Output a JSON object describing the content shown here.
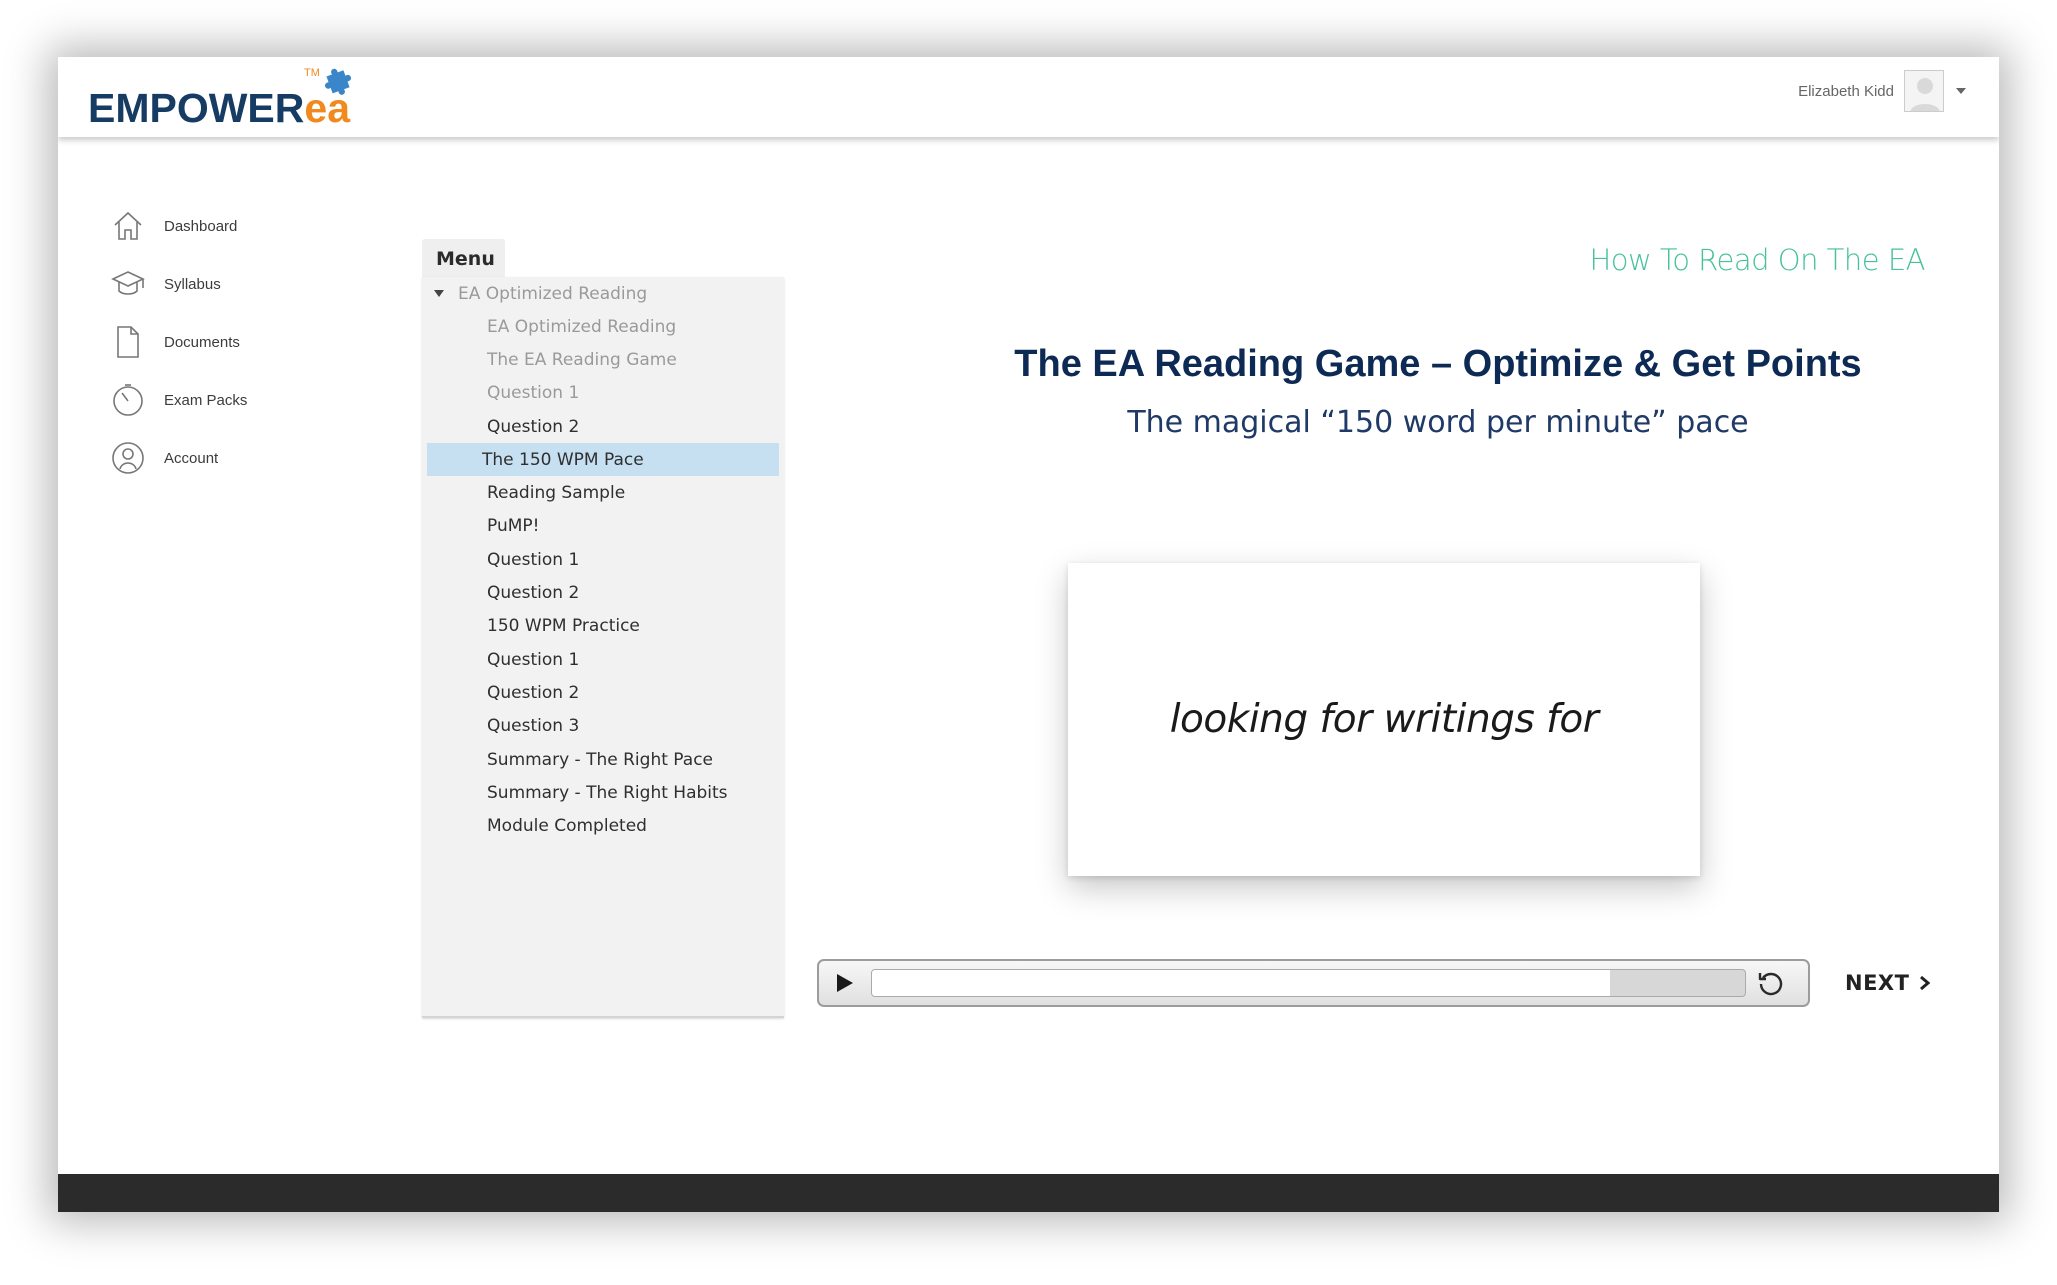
{
  "header": {
    "logo_main": "EMPOWER",
    "logo_accent": "ea",
    "logo_tm": "TM",
    "user_name": "Elizabeth Kidd"
  },
  "sidebar": {
    "items": [
      {
        "label": "Dashboard",
        "icon": "home-icon"
      },
      {
        "label": "Syllabus",
        "icon": "graduation-cap-icon"
      },
      {
        "label": "Documents",
        "icon": "document-icon"
      },
      {
        "label": "Exam Packs",
        "icon": "timer-icon"
      },
      {
        "label": "Account",
        "icon": "user-icon"
      }
    ]
  },
  "menu": {
    "title": "Menu",
    "root": "EA Optimized Reading",
    "items": [
      {
        "label": "EA Optimized Reading",
        "state": "visited"
      },
      {
        "label": "The EA Reading Game",
        "state": "visited"
      },
      {
        "label": "Question 1",
        "state": "visited"
      },
      {
        "label": "Question 2",
        "state": "normal"
      },
      {
        "label": "The 150 WPM Pace",
        "state": "active"
      },
      {
        "label": "Reading Sample",
        "state": "normal"
      },
      {
        "label": "PuMP!",
        "state": "normal"
      },
      {
        "label": "Question 1",
        "state": "normal"
      },
      {
        "label": "Question 2",
        "state": "normal"
      },
      {
        "label": "150 WPM Practice",
        "state": "normal"
      },
      {
        "label": "Question 1",
        "state": "normal"
      },
      {
        "label": "Question 2",
        "state": "normal"
      },
      {
        "label": "Question 3",
        "state": "normal"
      },
      {
        "label": "Summary - The Right Pace",
        "state": "normal"
      },
      {
        "label": "Summary - The Right Habits",
        "state": "normal"
      },
      {
        "label": "Module Completed",
        "state": "normal"
      }
    ]
  },
  "content": {
    "section_title": "How To Read On The EA",
    "title": "The EA Reading Game – Optimize & Get Points",
    "subtitle": "The magical “150 word per minute” pace",
    "card_text": "looking for writings for"
  },
  "player": {
    "progress": 0.845,
    "next_label": "NEXT"
  },
  "colors": {
    "brand_navy": "#173c64",
    "brand_orange": "#f08a1e",
    "accent_green": "#46c19c",
    "active_item": "#c6e0f2",
    "footer": "#2b2b2b"
  }
}
